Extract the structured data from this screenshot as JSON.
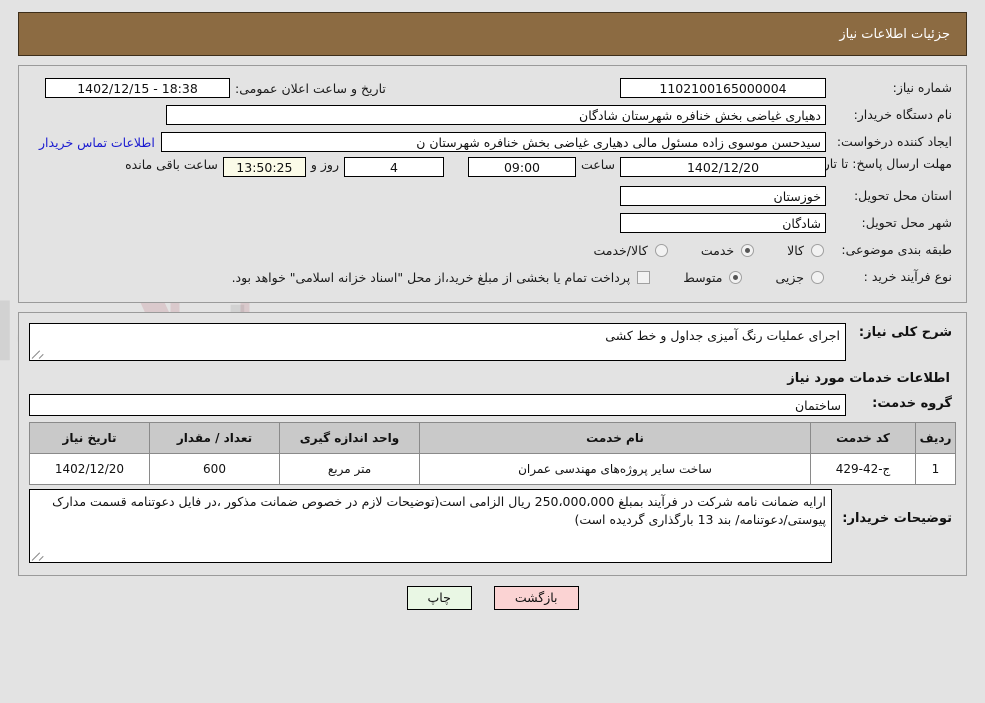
{
  "header": {
    "title": "جزئیات اطلاعات نیاز"
  },
  "top": {
    "need_number_label": "شماره نیاز:",
    "need_number_value": "1102100165000004",
    "announce_label": "تاریخ و ساعت اعلان عمومی:",
    "announce_value": "18:38 - 1402/12/15",
    "buyer_org_label": "نام دستگاه خریدار:",
    "buyer_org_value": "دهیاری غیاضی بخش خنافره شهرستان شادگان",
    "creator_label": "ایجاد کننده درخواست:",
    "creator_value": "سیدحسن موسوی زاده مسئول مالی دهیاری غیاضی بخش خنافره شهرستان ن",
    "contact_link": "اطلاعات تماس خریدار",
    "deadline_label": "مهلت ارسال پاسخ: تا تاریخ:",
    "deadline_date": "1402/12/20",
    "hour_label": "ساعت",
    "deadline_time": "09:00",
    "days_value": "4",
    "days_label": "روز و",
    "countdown_value": "13:50:25",
    "remaining_label": "ساعت باقی مانده",
    "province_label": "استان محل تحویل:",
    "province_value": "خوزستان",
    "city_label": "شهر محل تحویل:",
    "city_value": "شادگان",
    "category_label": "طبقه بندی موضوعی:",
    "category_options": [
      {
        "label": "کالا",
        "selected": false
      },
      {
        "label": "خدمت",
        "selected": true
      },
      {
        "label": "کالا/خدمت",
        "selected": false
      }
    ],
    "process_label": "نوع فرآیند خرید :",
    "process_options": [
      {
        "label": "جزیی",
        "selected": false
      },
      {
        "label": "متوسط",
        "selected": true
      }
    ],
    "treasury_checkbox_label": "پرداخت تمام یا بخشی از مبلغ خرید،از محل \"اسناد خزانه اسلامی\" خواهد بود.",
    "treasury_checked": false
  },
  "body": {
    "general_desc_label": "شرح کلی نیاز:",
    "general_desc_value": "اجرای عملیات رنگ آمیزی جداول و خط کشی",
    "services_section_title": "اطلاعات خدمات مورد نیاز",
    "service_group_label": "گروه خدمت:",
    "service_group_value": "ساختمان",
    "buyer_notes_label": "توضیحات خریدار:",
    "buyer_notes_value": "ارایه ضمانت نامه شرکت در فرآیند بمبلغ 250،000،000 ریال الزامی است(توضیحات لازم در خصوص ضمانت مذکور ،در فایل دعوتنامه قسمت مدارک پیوستی/دعوتنامه/ بند 13 بارگذاری گردیده است)"
  },
  "table": {
    "columns": [
      "ردیف",
      "کد خدمت",
      "نام خدمت",
      "واحد اندازه گیری",
      "تعداد / مقدار",
      "تاریخ نیاز"
    ],
    "rows": [
      {
        "row": "1",
        "code": "ج-42-429",
        "name": "ساخت سایر پروژه‌های مهندسی عمران",
        "unit": "متر مربع",
        "qty": "600",
        "date": "1402/12/20"
      }
    ]
  },
  "footer": {
    "print_label": "چاپ",
    "back_label": "بازگشت"
  },
  "colors": {
    "header_bg": "#8c6b42",
    "page_bg": "#e3e3e3",
    "link": "#1a1ad0",
    "table_header_bg": "#c9c9c9",
    "print_btn_bg": "#e9f7e4",
    "back_btn_bg": "#fbd3d3",
    "countdown_bg": "#fbfbe8"
  }
}
